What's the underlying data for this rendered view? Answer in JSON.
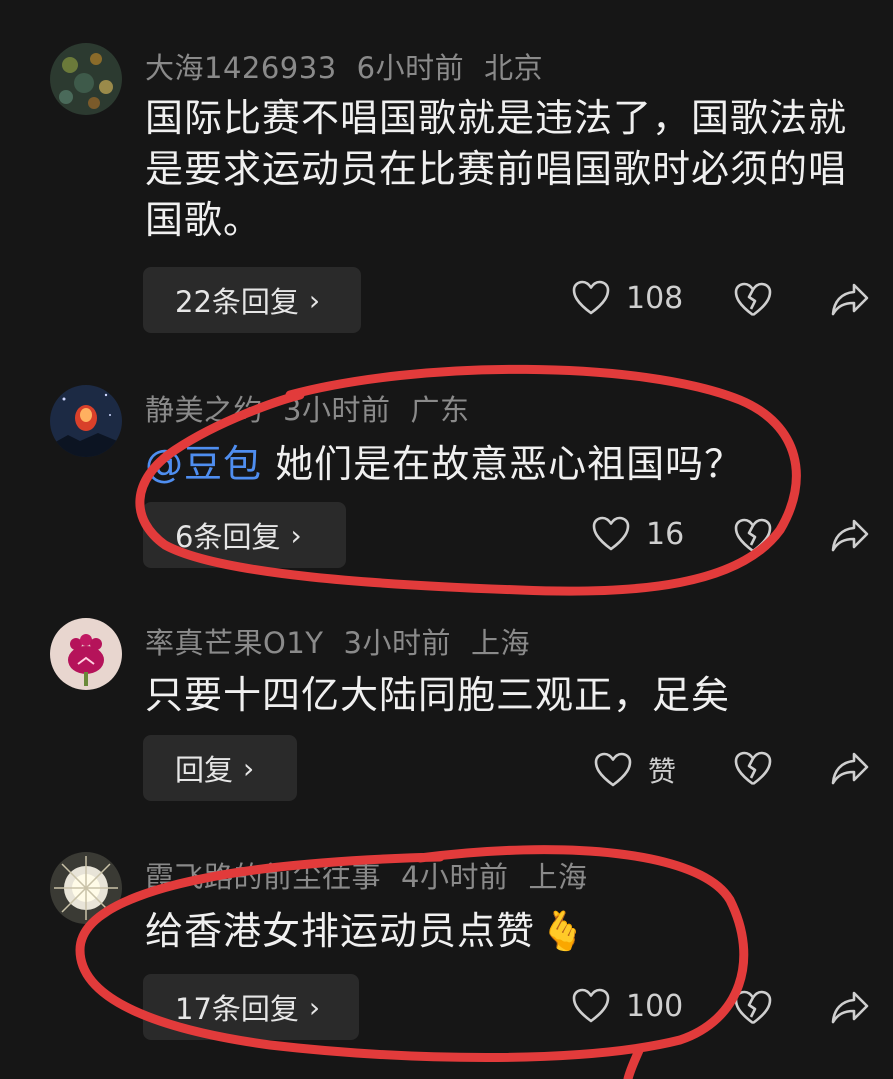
{
  "comments": [
    {
      "username": "大海1426933",
      "time": "6小时前",
      "location": "北京",
      "text": "国际比赛不唱国歌就是违法了，国歌法就是要求运动员在比赛前唱国歌时必须的唱国歌。",
      "reply_label": "22条回复",
      "likes": "108"
    },
    {
      "username": "静美之约",
      "time": "3小时前",
      "location": "广东",
      "mention": "@豆包",
      "text": " 她们是在故意恶心祖国吗？",
      "reply_label": "6条回复",
      "likes": "16"
    },
    {
      "username": "率真芒果O1Y",
      "time": "3小时前",
      "location": "上海",
      "text": "只要十四亿大陆同胞三观正，足矣",
      "reply_label": "回复",
      "likes": "赞"
    },
    {
      "username": "霞飞路的前尘往事",
      "time": "4小时前",
      "location": "上海",
      "text": "给香港女排运动员点赞",
      "emoji": "🫰",
      "reply_label": "17条回复",
      "likes": "100"
    }
  ],
  "icons": {
    "like": "heart-outline-icon",
    "dislike": "broken-heart-icon",
    "share": "share-arrow-icon",
    "chevron": "chevron-right-icon"
  },
  "colors": {
    "background": "#161616",
    "mention": "#4f8ef0",
    "annotation": "#e23b3b"
  }
}
